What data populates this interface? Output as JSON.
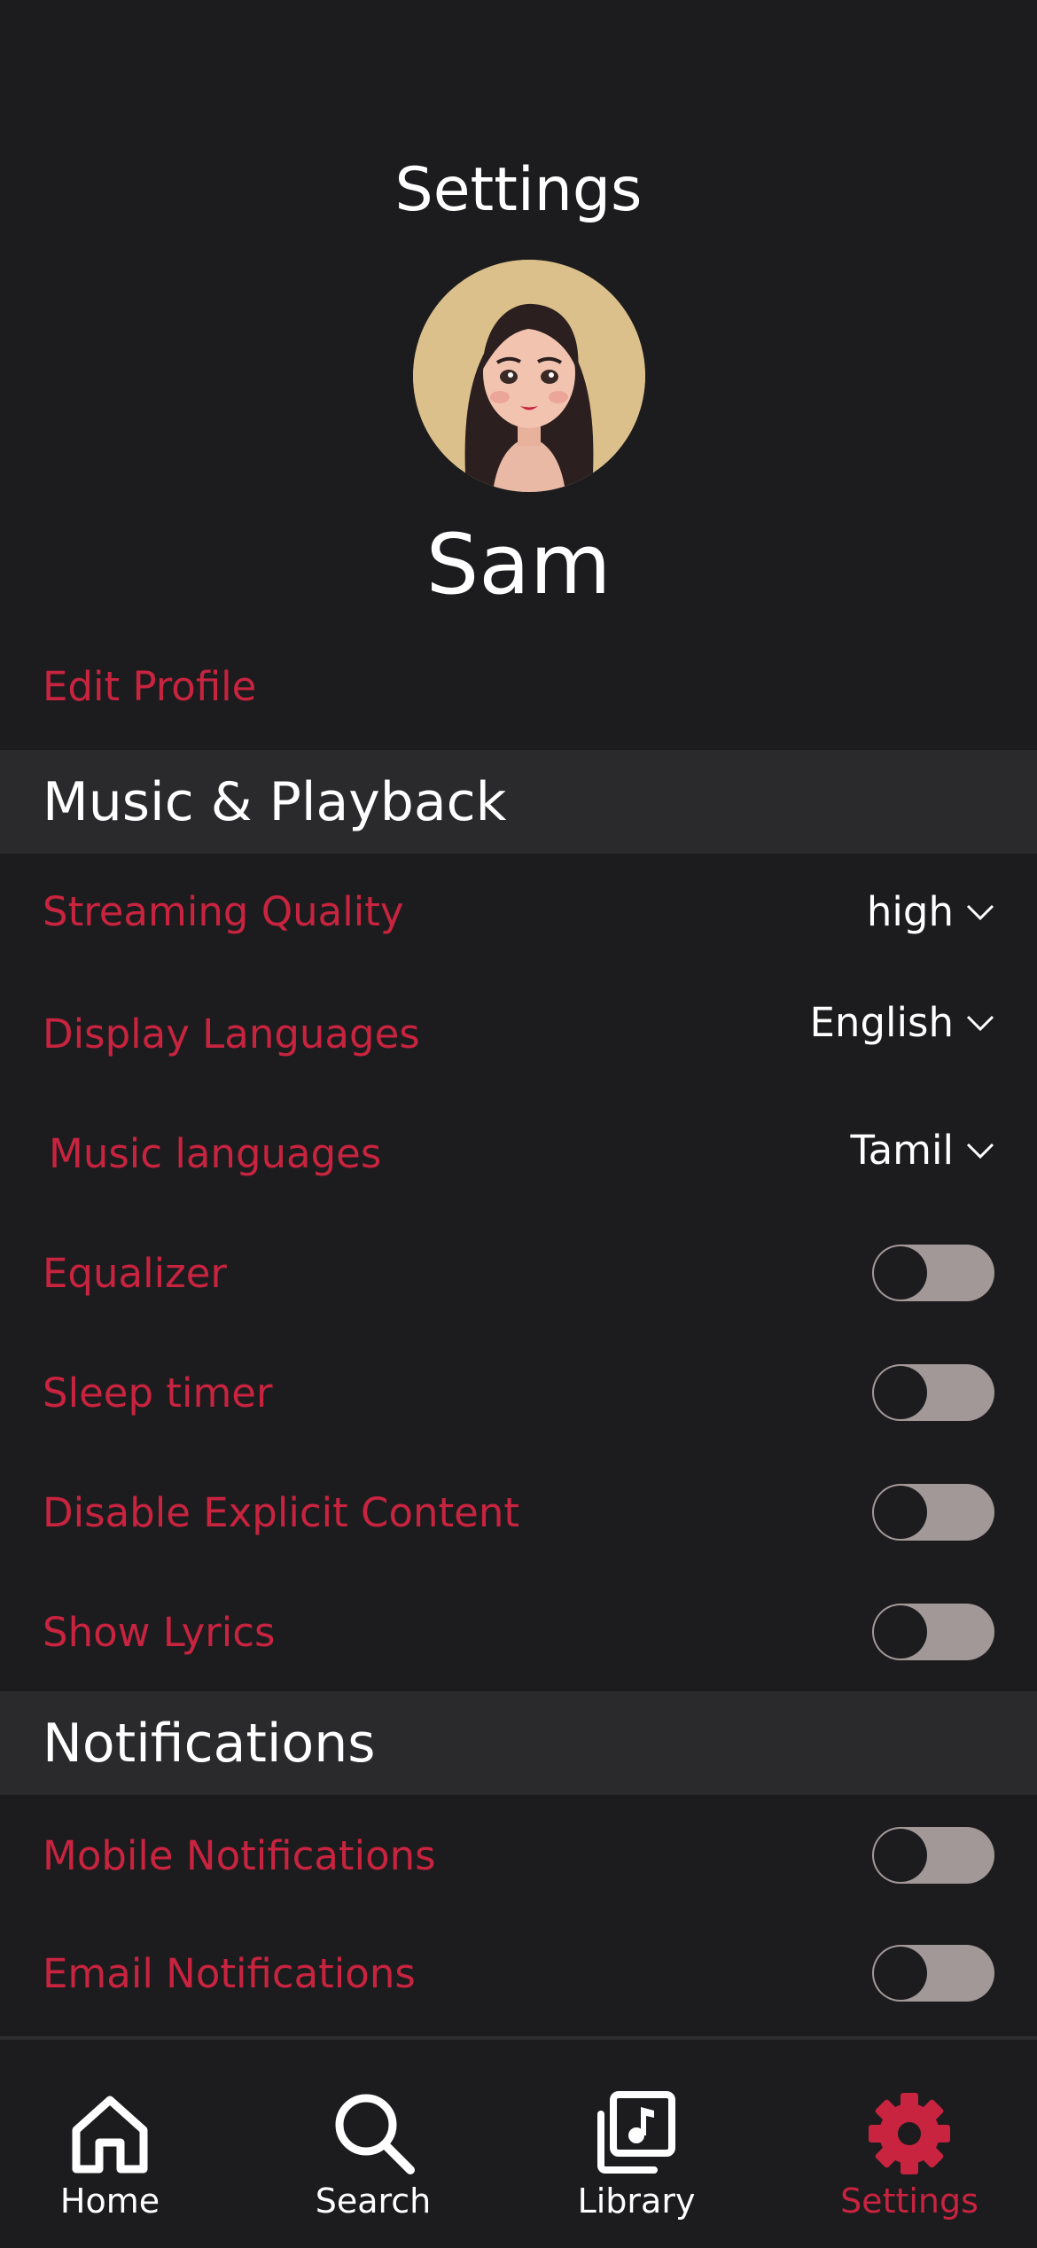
{
  "header": {
    "title": "Settings"
  },
  "profile": {
    "name": "Sam",
    "edit_label": "Edit Profile"
  },
  "sections": {
    "music": {
      "title": "Music & Playback",
      "streaming_quality": {
        "label": "Streaming Quality",
        "value": "high"
      },
      "display_languages": {
        "label": "Display Languages",
        "value": "English"
      },
      "music_languages": {
        "label": "Music languages",
        "value": "Tamil"
      },
      "equalizer": {
        "label": "Equalizer",
        "on": false
      },
      "sleep_timer": {
        "label": "Sleep timer",
        "on": false
      },
      "disable_explicit": {
        "label": "Disable Explicit Content",
        "on": false
      },
      "show_lyrics": {
        "label": "Show Lyrics",
        "on": false
      }
    },
    "notifications": {
      "title": "Notifications",
      "mobile": {
        "label": "Mobile Notifications",
        "on": false
      },
      "email": {
        "label": "Email Notifications",
        "on": false
      }
    }
  },
  "tabbar": {
    "home": "Home",
    "search": "Search",
    "library": "Library",
    "settings": "Settings",
    "active": "settings"
  },
  "colors": {
    "background": "#1c1c1e",
    "accent": "#c8233f",
    "section_header_bg": "#2a2a2c",
    "toggle_track": "#a39898",
    "avatar_bg": "#dcc08c"
  },
  "icons": [
    "avatar-illustration",
    "chevron-down-icon",
    "home-icon",
    "search-icon",
    "library-icon",
    "gear-icon"
  ]
}
